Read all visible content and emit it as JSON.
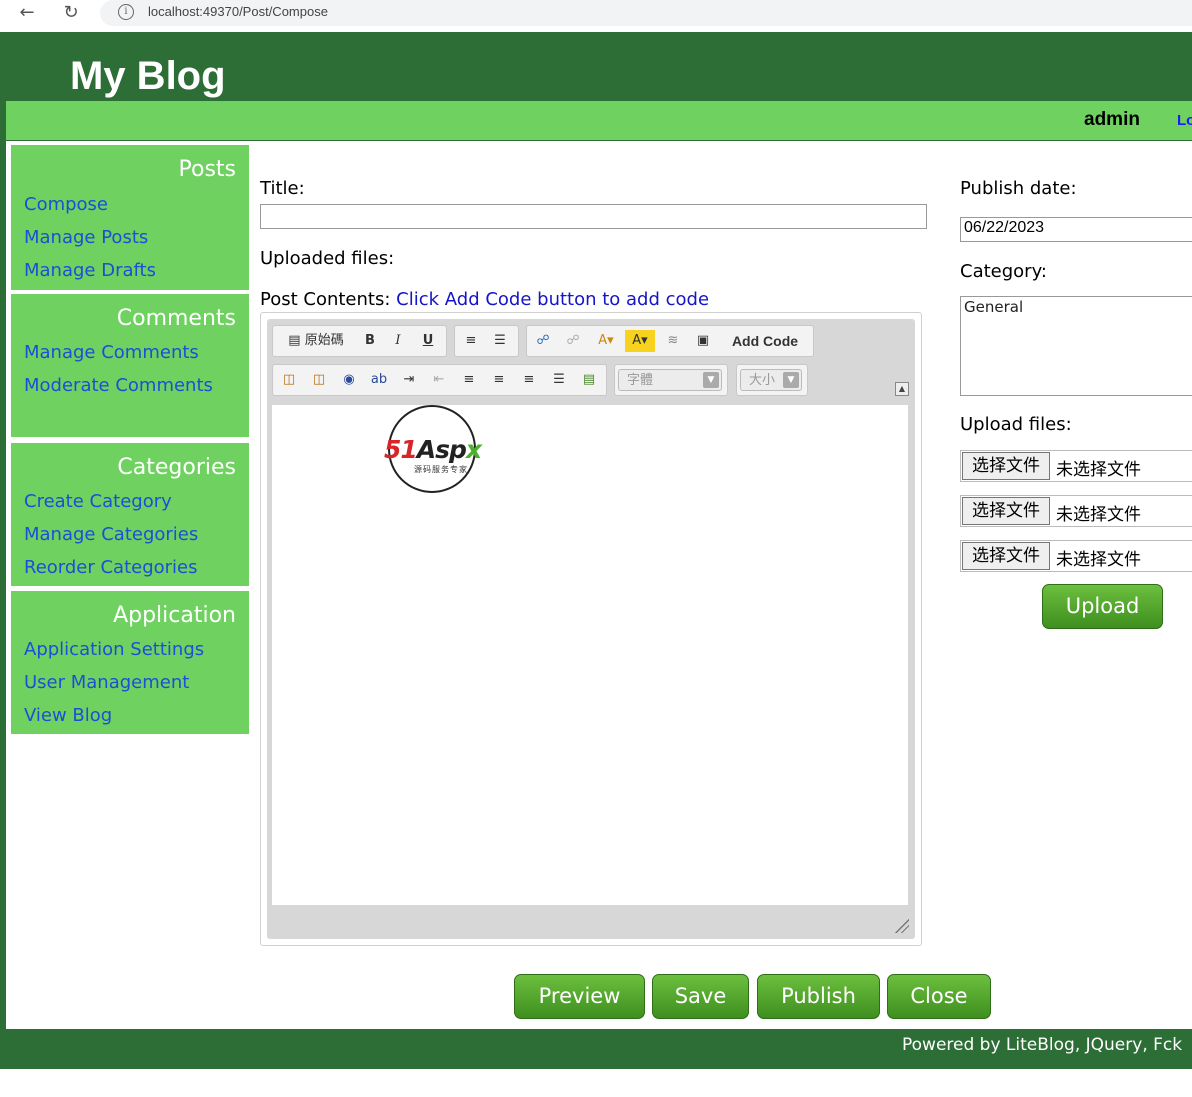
{
  "browser": {
    "url": "localhost:49370/Post/Compose"
  },
  "header": {
    "site_title": "My Blog",
    "username": "admin",
    "logout_label": "Lo"
  },
  "sidebar": {
    "sections": [
      {
        "title": "Posts",
        "links": [
          "Compose",
          "Manage Posts",
          "Manage Drafts"
        ]
      },
      {
        "title": "Comments",
        "links": [
          "Manage Comments",
          "Moderate Comments"
        ]
      },
      {
        "title": "Categories",
        "links": [
          "Create Category",
          "Manage Categories",
          "Reorder Categories"
        ]
      },
      {
        "title": "Application",
        "links": [
          "Application Settings",
          "User Management",
          "View Blog"
        ]
      }
    ]
  },
  "form": {
    "title_label": "Title:",
    "title_value": "",
    "uploaded_files_label": "Uploaded files:",
    "contents_label": "Post Contents:",
    "contents_hint": "Click Add Code button to add code",
    "publish_date_label": "Publish date:",
    "publish_date_value": "06/22/2023",
    "category_label": "Category:",
    "categories": [
      "General"
    ],
    "upload_files_label": "Upload files:",
    "file_choose_label": "选择文件",
    "file_none_label": "未选择文件",
    "upload_button": "Upload"
  },
  "editor": {
    "source_label": "原始碼",
    "add_code_label": "Add Code",
    "font_placeholder": "字體",
    "size_placeholder": "大小",
    "logo_text": [
      "51",
      "Asp",
      "x"
    ],
    "logo_subtitle": "源码服务专家"
  },
  "actions": {
    "preview": "Preview",
    "save": "Save",
    "publish": "Publish",
    "close": "Close"
  },
  "footer": {
    "text": "Powered by LiteBlog, JQuery, Fck"
  },
  "colors": {
    "dark_green": "#2c6e35",
    "light_green": "#6fd260",
    "link_blue": "#1a4fd6",
    "button_green": "#4fa22a"
  }
}
